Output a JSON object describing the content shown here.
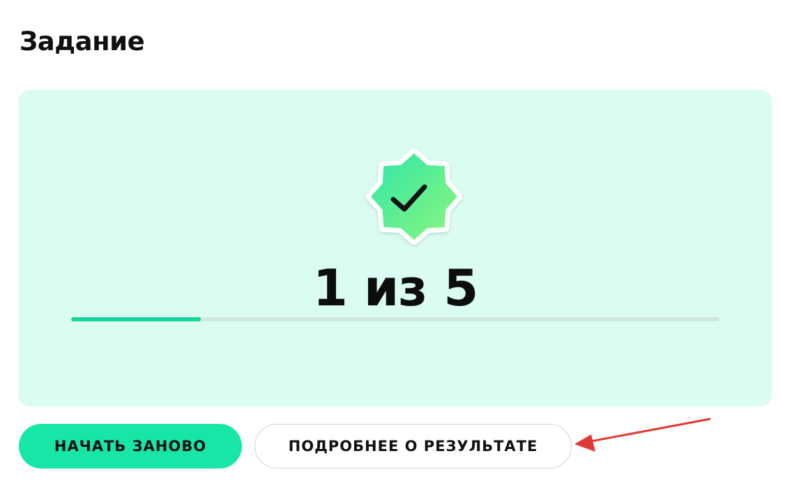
{
  "header": {
    "title": "Задание"
  },
  "result": {
    "score_text": "1 из 5",
    "progress_fraction": 0.2,
    "badge_icon": "checkmark-badge-icon",
    "colors": {
      "card_background": "#dbfcf1",
      "progress_fill": "#14d59a",
      "badge_gradient_start": "#2ee6a8",
      "badge_gradient_end": "#8cf77e"
    }
  },
  "actions": {
    "restart_label": "НАЧАТЬ ЗАНОВО",
    "details_label": "ПОДРОБНЕЕ О РЕЗУЛЬТАТЕ"
  },
  "annotation": {
    "arrow_color": "#e03a36"
  }
}
